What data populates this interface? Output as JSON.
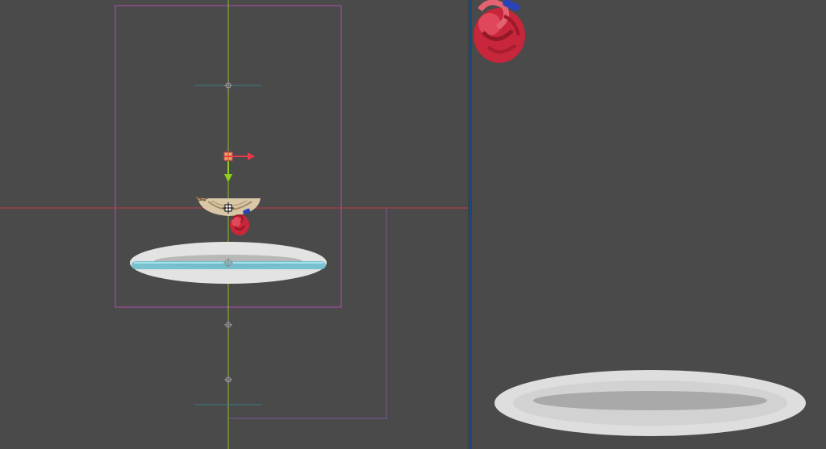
{
  "editor": {
    "scene_view": {
      "gizmo": "move-tool",
      "objects": [
        "heart-sprite",
        "nest-sprite",
        "plate-sprite"
      ]
    },
    "game_view": {
      "objects": [
        "heart-sprite",
        "plate-sprite"
      ]
    }
  },
  "colors": {
    "background": "#4a4a4a",
    "camera_bounds": "#b04cb0",
    "vertical_axis": "#8fbf2f",
    "horizontal_axis": "#d9334d",
    "handle_x": "#e8394b",
    "handle_y": "#8fd11a",
    "heart_red": "#c8263a",
    "heart_blue": "#2a44b8",
    "plate_white": "#dddddd",
    "plate_inner": "#a9a9a9",
    "selection_cyan": "#6cbecd"
  }
}
